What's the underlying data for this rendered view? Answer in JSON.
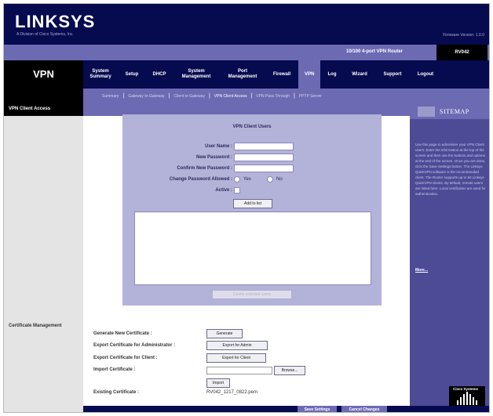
{
  "brand": {
    "logo_text": "LINKSYS",
    "subtitle": "A Division of Cisco Systems, Inc.",
    "firmware": "Firmware Version: 1.0.0"
  },
  "header": {
    "product_name": "10/100 4-port VPN Router",
    "model": "RV042",
    "section_title": "VPN"
  },
  "tabs": [
    {
      "label": "System Summary"
    },
    {
      "label": "Setup"
    },
    {
      "label": "DHCP"
    },
    {
      "label": "System Management"
    },
    {
      "label": "Port Management"
    },
    {
      "label": "Firewall"
    },
    {
      "label": "VPN",
      "active": true
    },
    {
      "label": "Log"
    },
    {
      "label": "Wizard"
    },
    {
      "label": "Support"
    },
    {
      "label": "Logout"
    }
  ],
  "subtabs": [
    {
      "label": "Summary"
    },
    {
      "label": "Gateway to Gateway"
    },
    {
      "label": "Client to Gateway"
    },
    {
      "label": "VPN Client Access",
      "current": true
    },
    {
      "label": "VPN Pass Through"
    },
    {
      "label": "PPTP Server"
    }
  ],
  "left": {
    "section1": "VPN Client Access",
    "section2": "Certificate Management"
  },
  "vpn_client": {
    "panel_title": "VPN Client Users",
    "username_label": "User Name :",
    "new_password_label": "New Password :",
    "confirm_password_label": "Confirm New Password :",
    "allow_change_label": "Change Password Allowed :",
    "yes_label": "Yes",
    "no_label": "No",
    "active_label": "Active :",
    "add_button": "Add to list",
    "delete_button": "Delete selected users"
  },
  "certificate": {
    "generate_label": "Generate New Certificate :",
    "generate_button": "Generate",
    "export_admin_label": "Export Certificate for Administrator :",
    "export_admin_button": "Export for Admin",
    "export_client_label": "Export Certificate for Client :",
    "export_client_button": "Export for Client",
    "import_label": "Import Certificate :",
    "browse_button": "Browse...",
    "import_button": "Import",
    "existing_label": "Existing Certificate :",
    "existing_value": "RV042_1217_0822.pem"
  },
  "sitemap": {
    "title": "SITEMAP",
    "help_text": "Use this page to administer your VPN Client users. Enter the information at the top of the screen and then use the buttons and options at the end of the screen. Once you are done, click the Save Settings button. The Linksys QuickVPN software is the recommended client. The Router supports up to 50 Linksys QuickVPN clients. By default, remote users are listed here. Local certificates are used for authentication.",
    "more_link": "More..."
  },
  "footer": {
    "save_button": "Save Settings",
    "cancel_button": "Cancel Changes",
    "cisco_label": "Cisco Systems"
  }
}
